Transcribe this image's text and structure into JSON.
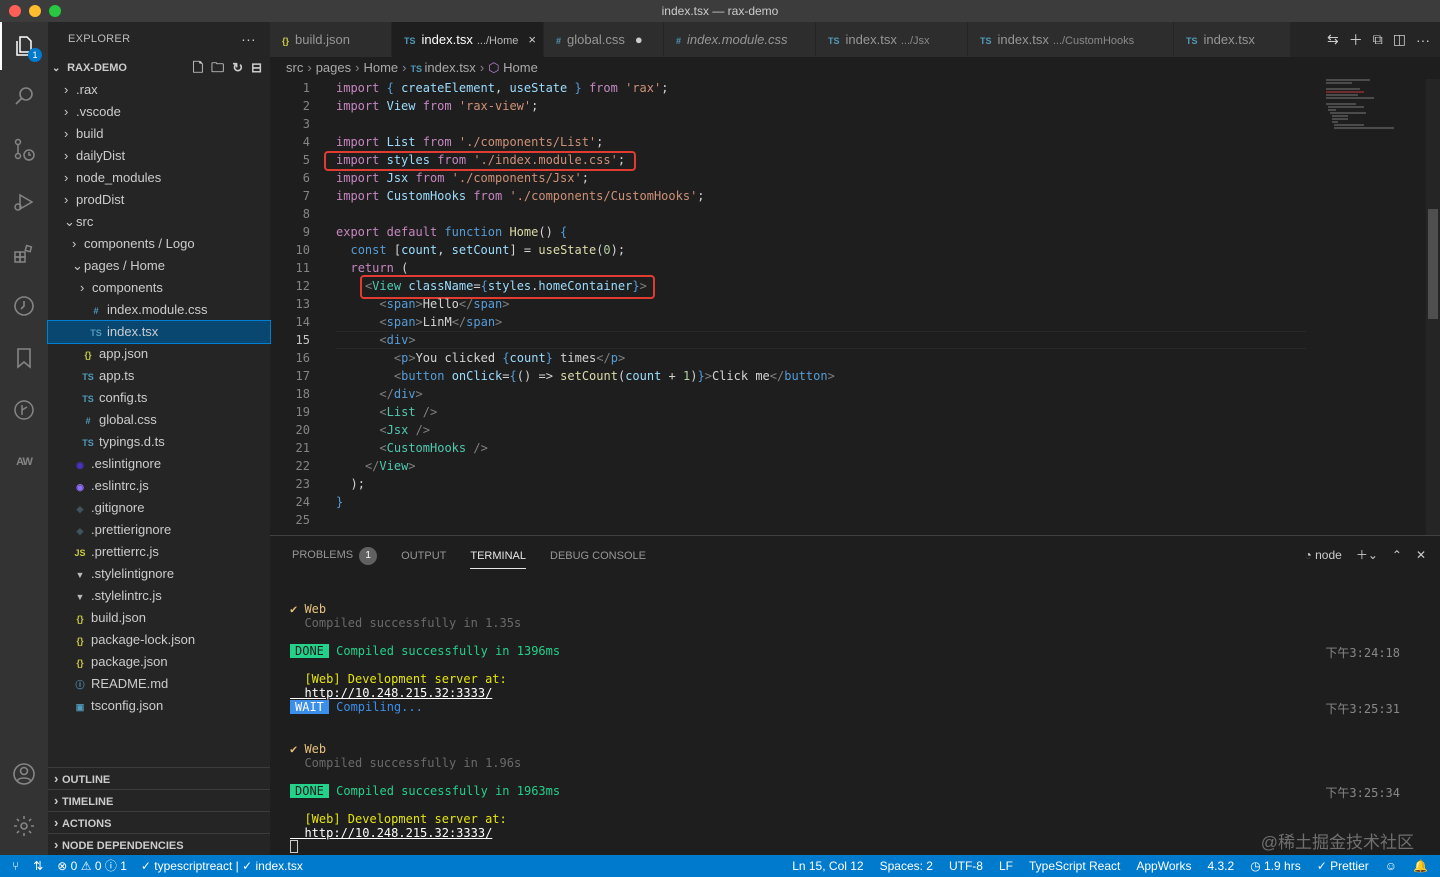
{
  "window": {
    "title": "index.tsx — rax-demo"
  },
  "explorer": {
    "title": "EXPLORER",
    "more": "···",
    "project": "RAX-DEMO",
    "items": [
      {
        "label": ".rax",
        "type": "folder",
        "open": false,
        "indent": 0
      },
      {
        "label": ".vscode",
        "type": "folder",
        "open": false,
        "indent": 0
      },
      {
        "label": "build",
        "type": "folder",
        "open": false,
        "indent": 0
      },
      {
        "label": "dailyDist",
        "type": "folder",
        "open": false,
        "indent": 0
      },
      {
        "label": "node_modules",
        "type": "folder",
        "open": false,
        "indent": 0
      },
      {
        "label": "prodDist",
        "type": "folder",
        "open": false,
        "indent": 0
      },
      {
        "label": "src",
        "type": "folder",
        "open": true,
        "indent": 0
      },
      {
        "label": "components / Logo",
        "type": "folder",
        "open": false,
        "indent": 1
      },
      {
        "label": "pages / Home",
        "type": "folder",
        "open": true,
        "indent": 1
      },
      {
        "label": "components",
        "type": "folder",
        "open": false,
        "indent": 2
      },
      {
        "label": "index.module.css",
        "type": "css",
        "indent": 2
      },
      {
        "label": "index.tsx",
        "type": "ts",
        "indent": 2,
        "selected": true
      },
      {
        "label": "app.json",
        "type": "json",
        "indent": 1
      },
      {
        "label": "app.ts",
        "type": "ts",
        "indent": 1
      },
      {
        "label": "config.ts",
        "type": "ts",
        "indent": 1
      },
      {
        "label": "global.css",
        "type": "css",
        "indent": 1
      },
      {
        "label": "typings.d.ts",
        "type": "ts",
        "indent": 1
      },
      {
        "label": ".eslintignore",
        "type": "eslint",
        "indent": 0
      },
      {
        "label": ".eslintrc.js",
        "type": "eslintrc",
        "indent": 0
      },
      {
        "label": ".gitignore",
        "type": "git",
        "indent": 0
      },
      {
        "label": ".prettierignore",
        "type": "prettier",
        "indent": 0
      },
      {
        "label": ".prettierrc.js",
        "type": "js",
        "indent": 0
      },
      {
        "label": ".stylelintignore",
        "type": "stylelint",
        "indent": 0
      },
      {
        "label": ".stylelintrc.js",
        "type": "stylelint",
        "indent": 0
      },
      {
        "label": "build.json",
        "type": "json",
        "indent": 0
      },
      {
        "label": "package-lock.json",
        "type": "json",
        "indent": 0
      },
      {
        "label": "package.json",
        "type": "json",
        "indent": 0
      },
      {
        "label": "README.md",
        "type": "info",
        "indent": 0
      },
      {
        "label": "tsconfig.json",
        "type": "tsconfig",
        "indent": 0
      }
    ],
    "panels": [
      "OUTLINE",
      "TIMELINE",
      "ACTIONS",
      "NODE DEPENDENCIES"
    ]
  },
  "tabs": [
    {
      "prefix": "{}",
      "name": "build.json",
      "desc": "",
      "active": false
    },
    {
      "prefix": "TS",
      "name": "index.tsx",
      "desc": ".../Home",
      "active": true,
      "close": "×"
    },
    {
      "prefix": "#",
      "name": "global.css",
      "desc": "",
      "active": false,
      "dirty": "●"
    },
    {
      "prefix": "#",
      "name": "index.module.css",
      "desc": "",
      "active": false,
      "italic": true
    },
    {
      "prefix": "TS",
      "name": "index.tsx",
      "desc": ".../Jsx",
      "active": false
    },
    {
      "prefix": "TS",
      "name": "index.tsx",
      "desc": ".../CustomHooks",
      "active": false
    },
    {
      "prefix": "TS",
      "name": "index.tsx",
      "desc": "",
      "active": false
    }
  ],
  "breadcrumb": [
    "src",
    "pages",
    "Home",
    "index.tsx",
    "Home"
  ],
  "editor": {
    "current_line": 15,
    "line_numbers": [
      "1",
      "2",
      "3",
      "4",
      "5",
      "6",
      "7",
      "8",
      "9",
      "10",
      "11",
      "12",
      "13",
      "14",
      "15",
      "16",
      "17",
      "18",
      "19",
      "20",
      "21",
      "22",
      "23",
      "24",
      "25"
    ],
    "lines": [
      "import { createElement, useState } from 'rax';",
      "import View from 'rax-view';",
      "",
      "import List from './components/List';",
      "import styles from './index.module.css';",
      "import Jsx from './components/Jsx';",
      "import CustomHooks from './components/CustomHooks';",
      "",
      "export default function Home() {",
      "  const [count, setCount] = useState(0);",
      "  return (",
      "    <View className={styles.homeContainer}>",
      "      <span>Hello</span>",
      "      <span>LinM</span>",
      "      <div>",
      "        <p>You clicked {count} times</p>",
      "        <button onClick={() => setCount(count + 1)}>Click me</button>",
      "      </div>",
      "      <List />",
      "      <Jsx />",
      "      <CustomHooks />",
      "    </View>",
      "  );",
      "}",
      ""
    ]
  },
  "panel": {
    "tabs": [
      "PROBLEMS",
      "OUTPUT",
      "TERMINAL",
      "DEBUG CONSOLE"
    ],
    "active": "TERMINAL",
    "problems_count": "1",
    "shell": "node",
    "terminal": {
      "web1": "✔ Web",
      "compiled1": "  Compiled successfully in 1.35s",
      "done": "DONE",
      "done1_text": " Compiled successfully in 1396ms",
      "ts1": "下午3:24:18",
      "server1": "  [Web] Development server at:",
      "url1": "  http://10.248.215.32:3333/",
      "wait": "WAIT",
      "compiling": " Compiling...",
      "ts2": "下午3:25:31",
      "web2": "✔ Web",
      "compiled2": "  Compiled successfully in 1.96s",
      "done2_text": " Compiled successfully in 1963ms",
      "ts3": "下午3:25:34",
      "server2": "  [Web] Development server at:",
      "url2": "  http://10.248.215.32:3333/"
    }
  },
  "status": {
    "errors": "0",
    "warnings": "0",
    "info": "1",
    "lang_check": "✓ typescriptreact | ✓ index.tsx",
    "position": "Ln 15, Col 12",
    "spaces": "Spaces: 2",
    "encoding": "UTF-8",
    "eol": "LF",
    "language": "TypeScript React",
    "appworks": "AppWorks",
    "version": "4.3.2",
    "time": "1.9 hrs",
    "prettier": "✓ Prettier"
  },
  "watermark": "@稀土掘金技术社区",
  "colors": {
    "accent": "#007acc",
    "highlight_box": "#e03c31"
  }
}
